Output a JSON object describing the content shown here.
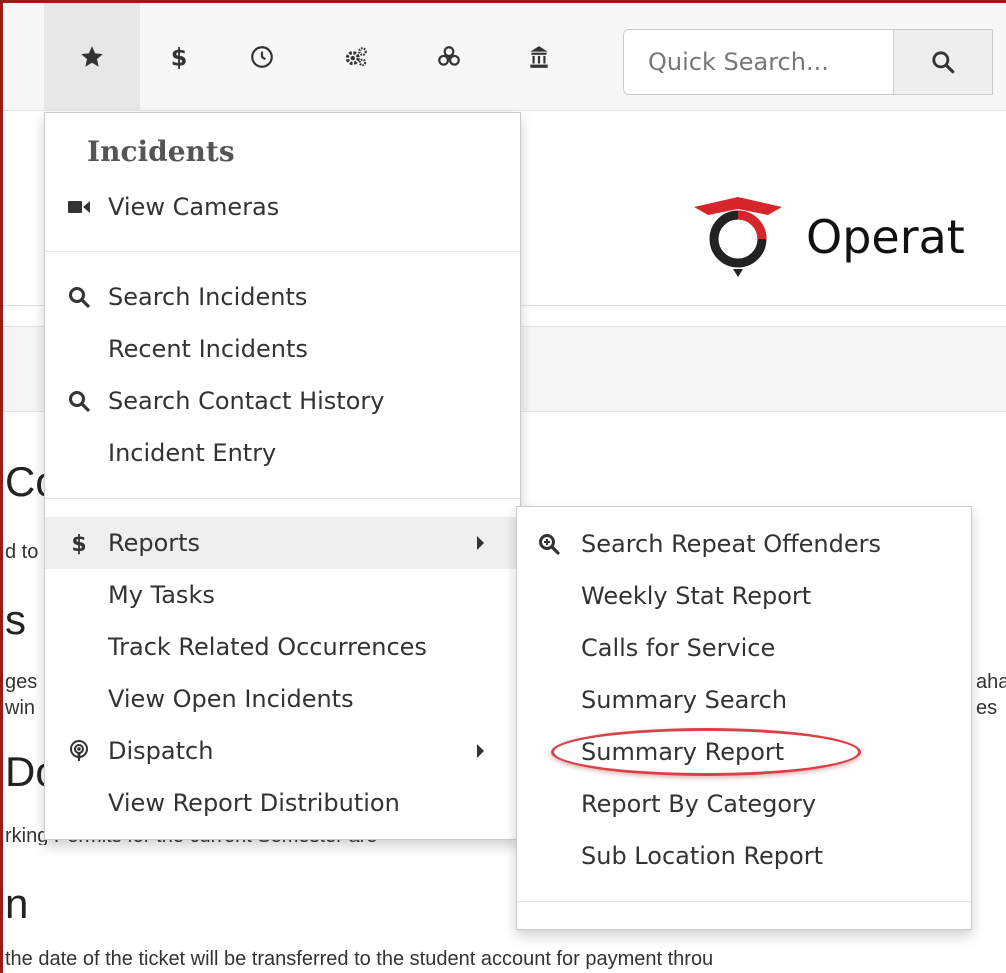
{
  "topbar": {
    "nav_icons": [
      "pin-icon",
      "star-icon",
      "dollar-icon",
      "clock-icon",
      "gears-icon",
      "biohazard-icon",
      "building-icon"
    ],
    "search": {
      "placeholder": "Quick Search..."
    }
  },
  "header": {
    "brand_text": "Operat"
  },
  "background": {
    "heading_1": "Co",
    "text_1": "d to",
    "heading_2": "s",
    "text_2a": "ges",
    "text_2b": "win",
    "text_right_1": "aha",
    "text_right_2": "es",
    "heading_3": "Do",
    "text_3": "rking Permits for the current Semester are",
    "heading_4": "n",
    "text_4": "the date of the ticket will be transferred to the student account for payment throu"
  },
  "menu": {
    "header": "Incidents",
    "items": [
      {
        "label": "View Cameras",
        "icon": "video-camera-icon"
      },
      {
        "label": "Search Incidents",
        "icon": "search-icon"
      },
      {
        "label": "Recent Incidents",
        "icon": ""
      },
      {
        "label": "Search Contact History",
        "icon": "search-icon"
      },
      {
        "label": "Incident Entry",
        "icon": ""
      },
      {
        "label": "Reports",
        "icon": "dollar-icon",
        "has_submenu": true
      },
      {
        "label": "My Tasks",
        "icon": ""
      },
      {
        "label": "Track Related Occurrences",
        "icon": ""
      },
      {
        "label": "View Open Incidents",
        "icon": ""
      },
      {
        "label": "Dispatch",
        "icon": "podcast-icon",
        "has_submenu": true
      },
      {
        "label": "View Report Distribution",
        "icon": ""
      }
    ]
  },
  "submenu": {
    "items": [
      {
        "label": "Search Repeat Offenders",
        "icon": "search-plus-icon"
      },
      {
        "label": "Weekly Stat Report"
      },
      {
        "label": "Calls for Service"
      },
      {
        "label": "Summary Search"
      },
      {
        "label": "Summary Report"
      },
      {
        "label": "Report By Category"
      },
      {
        "label": "Sub Location Report"
      }
    ]
  },
  "colors": {
    "frame": "#9b1b1b",
    "annotation": "#d9414a",
    "logo_red": "#d7262b",
    "logo_dark": "#222222"
  }
}
